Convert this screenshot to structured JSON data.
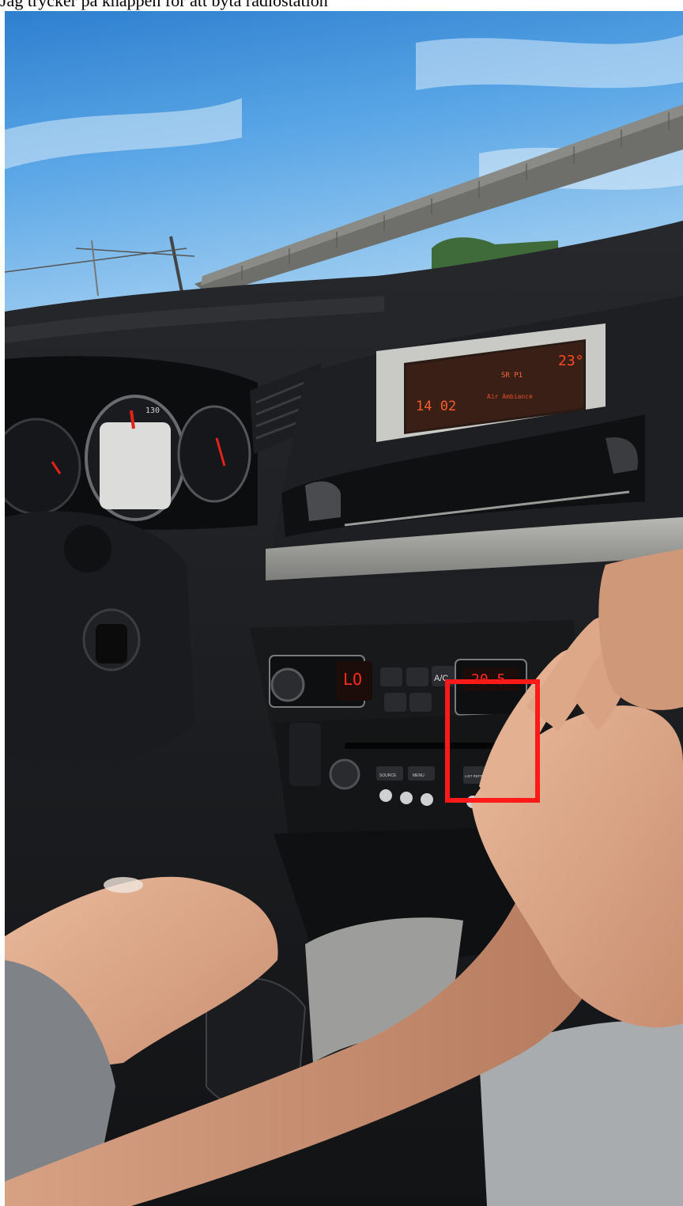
{
  "caption": "Jag trycker på knappen för att byta radiostation",
  "display": {
    "time": "14 02",
    "temperature": "23°",
    "station": "SR P1",
    "status": "Air Ambiance"
  },
  "climate": {
    "left_temp": "LO",
    "right_temp": "20.5",
    "ac_label": "A/C"
  },
  "radio": {
    "button_labels": [
      "SOURCE",
      "MENU",
      "LIST REFRESH"
    ]
  },
  "speedometer": {
    "max_label": "130"
  },
  "highlight": {
    "color": "#ff1a1a",
    "target": "radio-list-refresh-button"
  }
}
